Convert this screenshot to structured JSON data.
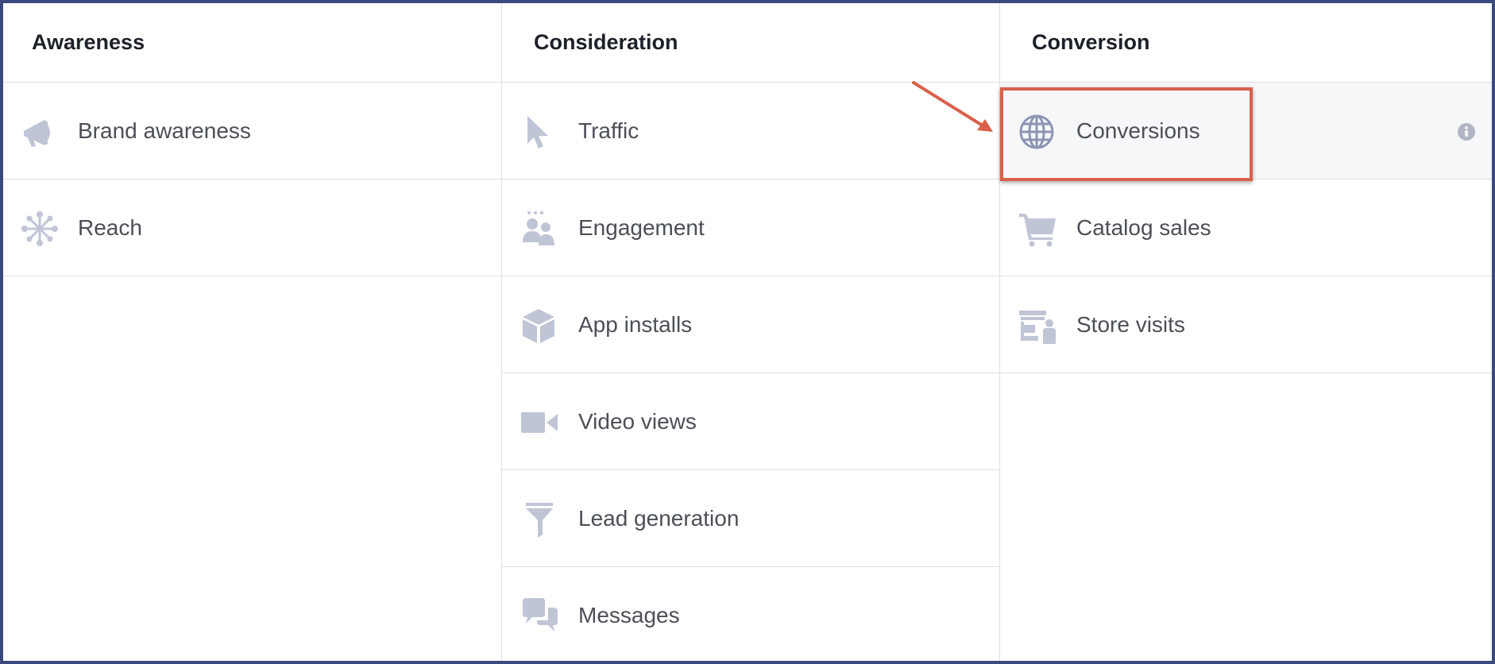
{
  "columns": [
    {
      "header": "Awareness",
      "items": [
        {
          "label": "Brand awareness",
          "icon": "megaphone-icon"
        },
        {
          "label": "Reach",
          "icon": "reach-network-icon"
        }
      ]
    },
    {
      "header": "Consideration",
      "items": [
        {
          "label": "Traffic",
          "icon": "cursor-icon"
        },
        {
          "label": "Engagement",
          "icon": "people-icon"
        },
        {
          "label": "App installs",
          "icon": "box-icon"
        },
        {
          "label": "Video views",
          "icon": "video-camera-icon"
        },
        {
          "label": "Lead generation",
          "icon": "funnel-icon"
        },
        {
          "label": "Messages",
          "icon": "chat-bubbles-icon"
        }
      ]
    },
    {
      "header": "Conversion",
      "items": [
        {
          "label": "Conversions",
          "icon": "globe-icon",
          "selected": true
        },
        {
          "label": "Catalog sales",
          "icon": "shopping-cart-icon"
        },
        {
          "label": "Store visits",
          "icon": "store-visit-icon"
        }
      ]
    }
  ],
  "colors": {
    "icon": "#c0c5d6",
    "icon_selected": "#8d95b3",
    "highlight": "#d9604a",
    "frame": "#3b4a7e"
  }
}
